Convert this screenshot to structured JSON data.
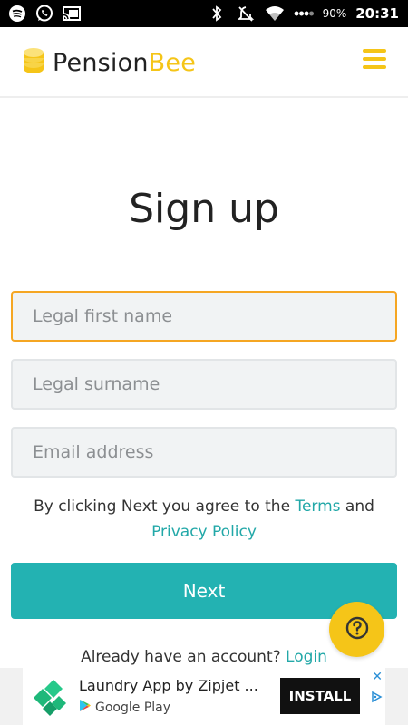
{
  "status_bar": {
    "battery": "90%",
    "time": "20:31"
  },
  "header": {
    "brand_part1": "Pension",
    "brand_part2": "Bee",
    "menu_icon": "hamburger-menu-icon"
  },
  "page_title": "Sign up",
  "form": {
    "first_name_placeholder": "Legal first name",
    "surname_placeholder": "Legal surname",
    "email_placeholder": "Email address"
  },
  "consent": {
    "prefix": "By clicking Next you agree to the ",
    "terms": "Terms",
    "and": " and",
    "privacy": "Privacy Policy"
  },
  "next_label": "Next",
  "login": {
    "prompt": "Already have an account? ",
    "link": "Login"
  },
  "ad": {
    "title": "Laundry App by Zipjet ...",
    "store": "Google Play",
    "install_label": "INSTALL",
    "close": "✕"
  },
  "colors": {
    "brand_yellow": "#f5c518",
    "accent_teal": "#23b2b2",
    "focus_orange": "#f5a623"
  }
}
